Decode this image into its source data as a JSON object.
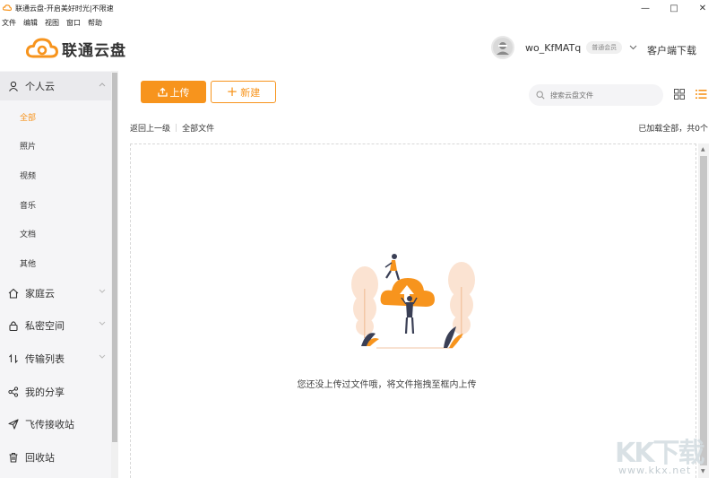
{
  "window": {
    "title": "联通云盘-开启美好时光|不限速",
    "controls": {
      "minimize": "—",
      "maximize": "□",
      "close": "✕"
    }
  },
  "menu": [
    "文件",
    "编辑",
    "视图",
    "窗口",
    "帮助"
  ],
  "header": {
    "logo_text": "联通云盘",
    "username": "wo_KfMATq",
    "member_badge": "普通会员",
    "download_client": "客户端下载"
  },
  "sidebar": {
    "personal_cloud": {
      "label": "个人云",
      "items": [
        "全部",
        "照片",
        "视频",
        "音乐",
        "文档",
        "其他"
      ],
      "active": "全部"
    },
    "family_cloud": "家庭云",
    "private_space": "私密空间",
    "transfer_list": "传输列表",
    "my_share": "我的分享",
    "fly_receive": "飞传接收站",
    "recycle_bin": "回收站"
  },
  "toolbar": {
    "upload_label": "上传",
    "new_label": "新建",
    "search_placeholder": "搜索云盘文件"
  },
  "breadcrumb": {
    "back": "返回上一级",
    "current": "全部文件"
  },
  "load_status": "已加载全部，共0个",
  "empty_state": {
    "message": "您还没上传过文件哦，将文件拖拽至框内上传"
  },
  "watermark": {
    "logo": "KK下载",
    "url": "www.kkx.net"
  },
  "colors": {
    "accent": "#f7941d",
    "sidebar_bg": "#f5f5f7"
  }
}
